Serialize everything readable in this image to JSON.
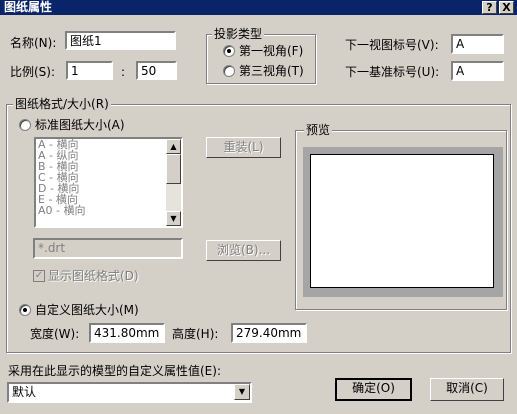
{
  "window": {
    "title": "图纸属性",
    "help_button": "?",
    "close_button": "X"
  },
  "name": {
    "label": "名称(N):",
    "value": "图纸1"
  },
  "scale": {
    "label": "比例(S):",
    "left_value": "1",
    "separator": ":",
    "right_value": "50"
  },
  "projection": {
    "title": "投影类型",
    "options": [
      {
        "label": "第一视角(F)",
        "selected": true
      },
      {
        "label": "第三视角(T)",
        "selected": false
      }
    ]
  },
  "next_view_label": {
    "label": "下一视图标号(V):",
    "value": "A"
  },
  "next_datum_label": {
    "label": "下一基准标号(U):",
    "value": "A"
  },
  "sheet_format": {
    "title": "图纸格式/大小(R)",
    "standard_radio": "标准图纸大小(A)",
    "list_items": [
      "A - 横向",
      "A - 纵向",
      "B - 横向",
      "C - 横向",
      "D - 横向",
      "E - 横向",
      "A0 - 横向"
    ],
    "reload_button": "重装(L)",
    "file_value": "*.drt",
    "browse_button": "浏览(B)...",
    "show_format_checkbox": "显示图纸格式(D)",
    "custom_radio": "自定义图纸大小(M)",
    "width_label": "宽度(W):",
    "width_value": "431.80mm",
    "height_label": "高度(H):",
    "height_value": "279.40mm",
    "preview_title": "预览"
  },
  "custom_property": {
    "label": "采用在此显示的模型的自定义属性值(E):",
    "value": "默认"
  },
  "buttons": {
    "ok": "确定(O)",
    "cancel": "取消(C)"
  }
}
